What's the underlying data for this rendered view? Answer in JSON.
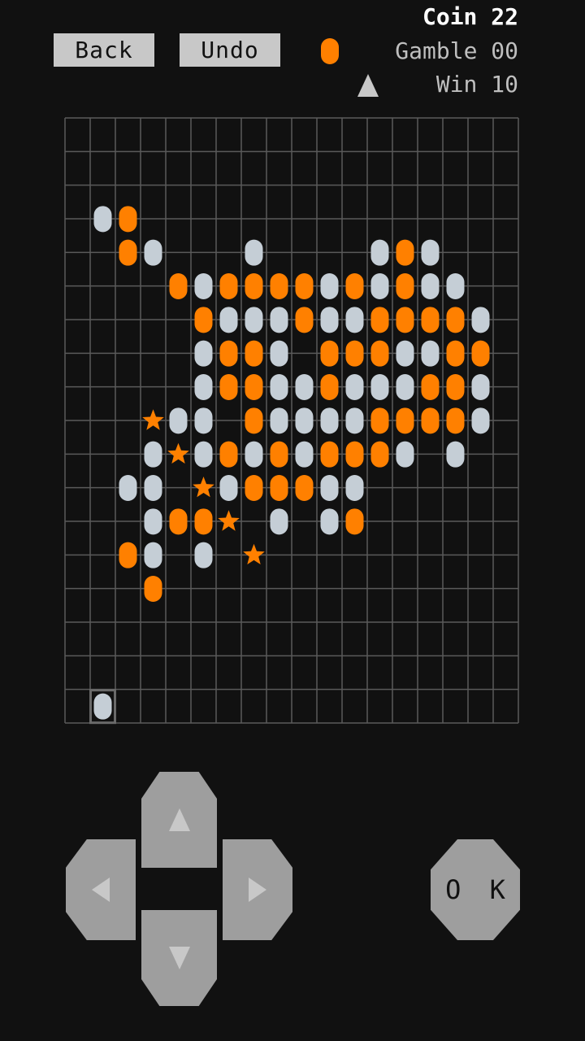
{
  "header": {
    "back_label": "Back",
    "undo_label": "Undo",
    "coin": "Coin 22",
    "gamble": "Gamble 00",
    "win": "Win 10",
    "turn_stone": "orange",
    "turn_marker_icon": "triangle-up-icon"
  },
  "colors": {
    "background": "#111111",
    "grid_line": "#5a5a5a",
    "orange_stone": "#ff8000",
    "white_stone": "#c5ced6",
    "button": "#c8c8c8",
    "pad": "#9e9e9e"
  },
  "board": {
    "cols": 18,
    "rows": 18,
    "cursor": [
      18,
      2
    ],
    "stones": [
      [
        "3.5",
        2,
        1
      ],
      [
        "3.5",
        3,
        3
      ],
      [
        "4.5",
        3,
        3
      ],
      [
        "4.5",
        4,
        2
      ],
      [
        "4.5",
        8,
        2
      ],
      [
        "4.5",
        13,
        2
      ],
      [
        "4.5",
        14,
        3
      ],
      [
        "4.5",
        15,
        2
      ],
      [
        "5.5",
        5,
        3
      ],
      [
        "5.5",
        6,
        1
      ],
      [
        "5.5",
        7,
        3
      ],
      [
        "5.5",
        8,
        3
      ],
      [
        "5.5",
        9,
        3
      ],
      [
        "5.5",
        10,
        3
      ],
      [
        "5.5",
        11,
        2
      ],
      [
        "5.5",
        12,
        3
      ],
      [
        "5.5",
        13,
        2
      ],
      [
        "5.5",
        14,
        3
      ],
      [
        "5.5",
        15,
        2
      ],
      [
        "5.5",
        16,
        2
      ],
      [
        "6.5",
        6,
        3
      ],
      [
        "6.5",
        7,
        1
      ],
      [
        "6.5",
        8,
        1
      ],
      [
        "6.5",
        9,
        1
      ],
      [
        "6.5",
        10,
        3
      ],
      [
        "6.5",
        11,
        1
      ],
      [
        "6.5",
        12,
        1
      ],
      [
        "6.5",
        13,
        3
      ],
      [
        "6.5",
        14,
        3
      ],
      [
        "6.5",
        15,
        3
      ],
      [
        "6.5",
        16,
        3
      ],
      [
        "6.5",
        17,
        1
      ],
      [
        "7.5",
        6,
        1
      ],
      [
        "7.5",
        7,
        3
      ],
      [
        "7.5",
        8,
        3
      ],
      [
        "7.5",
        9,
        1
      ],
      [
        "7.5",
        11,
        3
      ],
      [
        "7.5",
        12,
        3
      ],
      [
        "7.5",
        13,
        3
      ],
      [
        "7.5",
        14,
        1
      ],
      [
        "7.5",
        15,
        1
      ],
      [
        "7.5",
        16,
        3
      ],
      [
        "7.5",
        17,
        3
      ],
      [
        "8.5",
        6,
        1
      ],
      [
        "8.5",
        7,
        3
      ],
      [
        "8.5",
        8,
        3
      ],
      [
        "8.5",
        9,
        1
      ],
      [
        "8.5",
        10,
        1
      ],
      [
        "8.5",
        11,
        3
      ],
      [
        "8.5",
        12,
        1
      ],
      [
        "8.5",
        13,
        1
      ],
      [
        "8.5",
        14,
        1
      ],
      [
        "8.5",
        15,
        3
      ],
      [
        "8.5",
        16,
        3
      ],
      [
        "8.5",
        17,
        1
      ],
      [
        "9.5",
        4,
        4
      ],
      [
        "9.5",
        5,
        1
      ],
      [
        "9.5",
        6,
        1
      ],
      [
        "9.5",
        8,
        3
      ],
      [
        "9.5",
        9,
        1
      ],
      [
        "9.5",
        10,
        1
      ],
      [
        "9.5",
        11,
        1
      ],
      [
        "9.5",
        12,
        1
      ],
      [
        "9.5",
        13,
        3
      ],
      [
        "9.5",
        14,
        3
      ],
      [
        "9.5",
        15,
        3
      ],
      [
        "9.5",
        16,
        3
      ],
      [
        "9.5",
        17,
        1
      ],
      [
        "10.5",
        4,
        1
      ],
      [
        "10.5",
        5,
        4
      ],
      [
        "10.5",
        6,
        1
      ],
      [
        "10.5",
        7,
        3
      ],
      [
        "10.5",
        8,
        1
      ],
      [
        "10.5",
        9,
        3
      ],
      [
        "10.5",
        10,
        1
      ],
      [
        "10.5",
        11,
        3
      ],
      [
        "10.5",
        12,
        3
      ],
      [
        "10.5",
        13,
        3
      ],
      [
        "10.5",
        14,
        1
      ],
      [
        "10.5",
        16,
        1
      ],
      [
        "11.5",
        3,
        1
      ],
      [
        "11.5",
        4,
        1
      ],
      [
        "11.5",
        6,
        4
      ],
      [
        "11.5",
        7,
        1
      ],
      [
        "11.5",
        8,
        3
      ],
      [
        "11.5",
        9,
        3
      ],
      [
        "11.5",
        10,
        3
      ],
      [
        "11.5",
        11,
        1
      ],
      [
        "11.5",
        12,
        1
      ],
      [
        "12.5",
        4,
        1
      ],
      [
        "12.5",
        5,
        3
      ],
      [
        "12.5",
        6,
        3
      ],
      [
        "12.5",
        7,
        4
      ],
      [
        "12.5",
        9,
        1
      ],
      [
        "12.5",
        11,
        1
      ],
      [
        "12.5",
        12,
        3
      ],
      [
        "13.5",
        3,
        3
      ],
      [
        "13.5",
        4,
        1
      ],
      [
        "13.5",
        6,
        1
      ],
      [
        "13.5",
        8,
        4
      ],
      [
        "14.5",
        4,
        3
      ]
    ]
  },
  "controls": {
    "up_icon": "arrow-up-icon",
    "down_icon": "arrow-down-icon",
    "left_icon": "arrow-left-icon",
    "right_icon": "arrow-right-icon",
    "ok_label": "O K"
  }
}
